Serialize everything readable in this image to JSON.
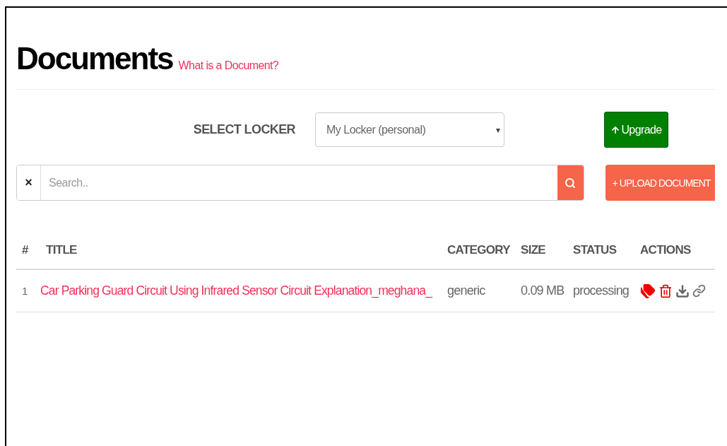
{
  "header": {
    "title": "Documents",
    "help_link": "What is a Document?"
  },
  "locker": {
    "label": "SELECT LOCKER",
    "value": "My Locker (personal)",
    "caret": "▾",
    "upgrade_button": "Upgrade"
  },
  "search": {
    "clear": "×",
    "placeholder": "Search..",
    "upload_button": "+ UPLOAD DOCUMENT"
  },
  "table": {
    "columns": [
      "#",
      "TITLE",
      "CATEGORY",
      "SIZE",
      "STATUS",
      "ACTIONS"
    ],
    "rows": [
      {
        "number": "1",
        "title": "Car Parking Guard Circuit Using Infrared Sensor Circuit Explanation_meghana_",
        "category": "generic",
        "size": "0.09 MB",
        "status": "processing"
      }
    ]
  }
}
